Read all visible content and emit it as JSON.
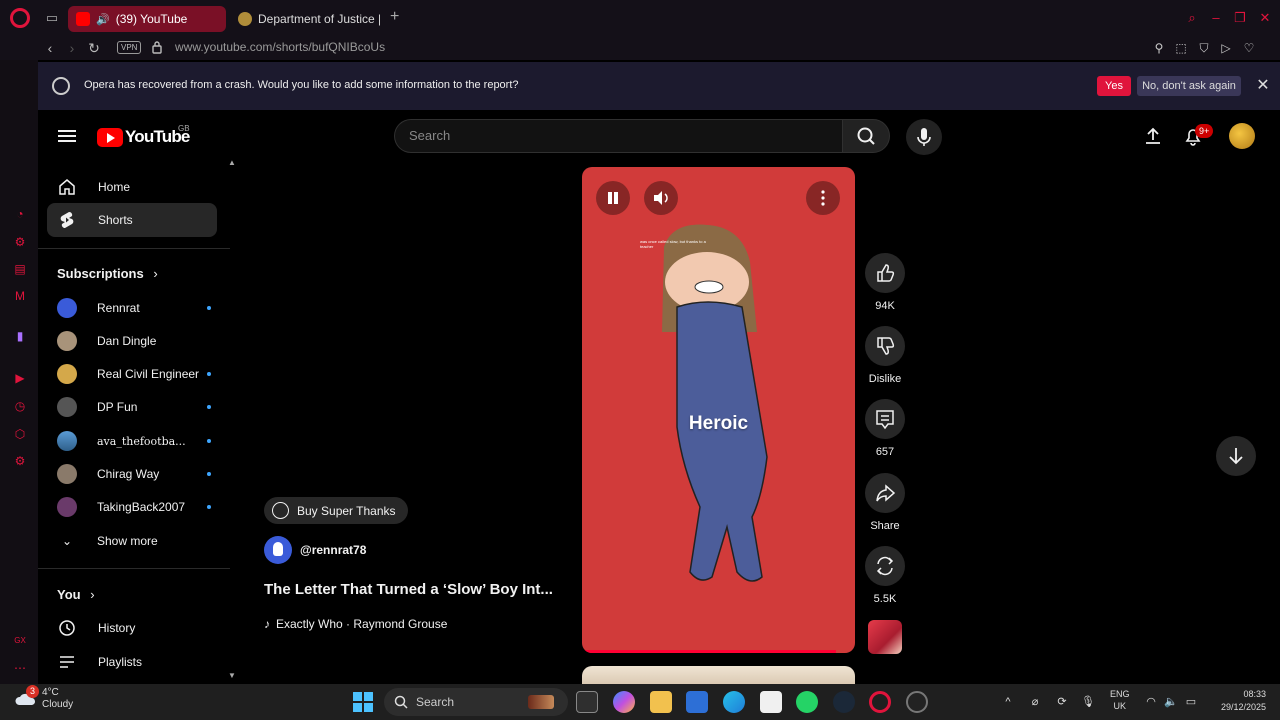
{
  "browser": {
    "tabs": [
      {
        "label": "(39) YouTube",
        "active": true
      },
      {
        "label": "Department of Justice | Ep",
        "active": false
      }
    ],
    "url": "www.youtube.com/shorts/bufQNIBcoUs",
    "vpn_label": "VPN"
  },
  "crash_bar": {
    "message": "Opera has recovered from a crash. Would you like to add some information to the report?",
    "yes_label": "Yes",
    "no_label": "No, don't ask again"
  },
  "youtube": {
    "logo_text": "YouTube",
    "country": "GB",
    "search_placeholder": "Search",
    "notification_count": "9+"
  },
  "nav": {
    "items": [
      {
        "label": "Home",
        "icon": "home-icon"
      },
      {
        "label": "Shorts",
        "icon": "shorts-icon",
        "active": true
      }
    ],
    "subscriptions_label": "Subscriptions",
    "subscriptions": [
      {
        "name": "Rennrat",
        "new": true
      },
      {
        "name": "Dan Dingle",
        "new": false
      },
      {
        "name": "Real Civil Engineer",
        "new": true
      },
      {
        "name": "DP Fun",
        "new": true
      },
      {
        "name": "ava_thefootba...",
        "new": true
      },
      {
        "name": "Chirag Way",
        "new": true
      },
      {
        "name": "TakingBack2007",
        "new": true
      }
    ],
    "show_more_label": "Show more",
    "you_label": "You",
    "you_items": [
      {
        "label": "History",
        "icon": "history-icon"
      },
      {
        "label": "Playlists",
        "icon": "playlists-icon"
      }
    ]
  },
  "short": {
    "super_thanks_label": "Buy Super Thanks",
    "channel": "@rennrat78",
    "title": "The Letter That Turned a ‘Slow’ Boy Int...",
    "music": "Exactly Who · Raymond Grouse",
    "overlay_text": "Heroic",
    "caption_small": "was once called slow, but thanks to a teacher",
    "progress_fraction": 0.93,
    "actions": {
      "likes": "94K",
      "dislike_label": "Dislike",
      "comments": "657",
      "share_label": "Share",
      "remix": "5.5K"
    }
  },
  "taskbar": {
    "temp": "4°C",
    "weather": "Cloudy",
    "weather_badge": "3",
    "search_label": "Search",
    "lang_1": "ENG",
    "lang_2": "UK",
    "time": "08:33",
    "date": "29/12/2025"
  }
}
